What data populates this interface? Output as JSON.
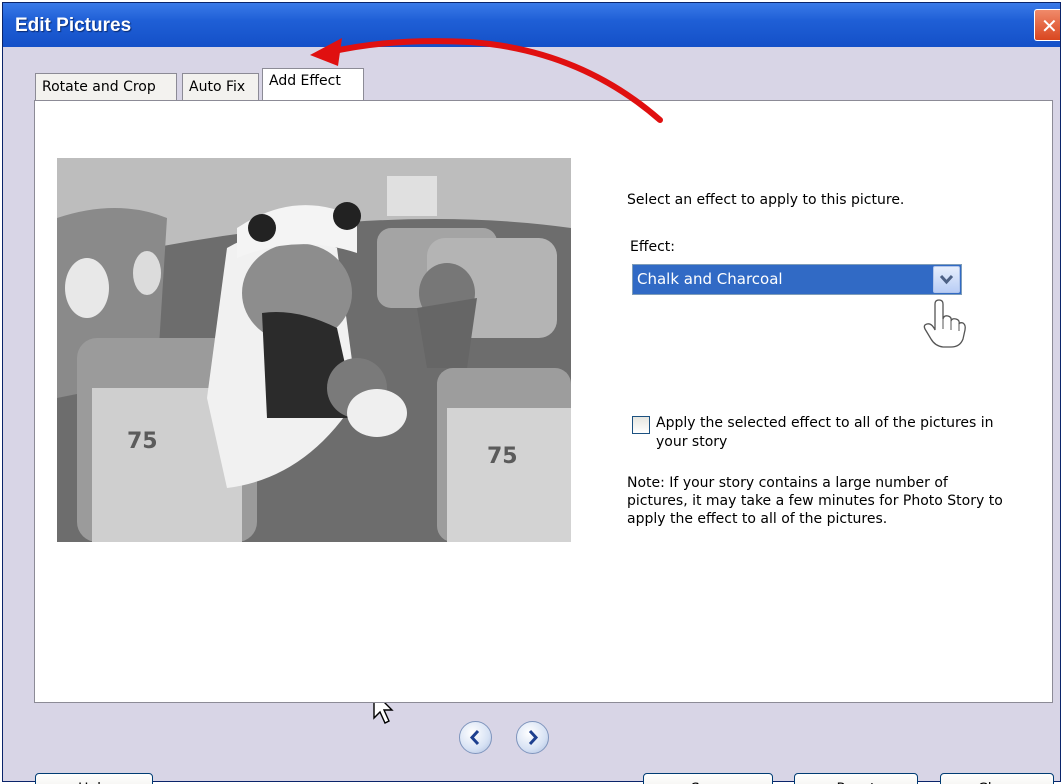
{
  "window": {
    "title": "Edit Pictures"
  },
  "tabs": [
    {
      "label": "Rotate and Crop"
    },
    {
      "label": "Auto Fix"
    },
    {
      "label": "Add Effect"
    }
  ],
  "effect_panel": {
    "instruction": "Select an effect to apply to this picture.",
    "effect_label": "Effect:",
    "effect_value": "Chalk and Charcoal",
    "apply_all_label": "Apply the selected effect to all of the pictures in your story",
    "apply_all_checked": false,
    "note": "Note: If your story contains a large number of pictures, it may take a few minutes for Photo Story to apply the effect to all of the pictures."
  },
  "buttons": {
    "help": "Help",
    "save": "Save",
    "reset": "Reset",
    "close": "Close"
  },
  "colors": {
    "titlebar": "#1f5fd6",
    "selection": "#316ac5",
    "annotation_arrow": "#e01010"
  },
  "icons": [
    "close-icon",
    "chevron-down-icon",
    "hand-cursor-icon",
    "previous-icon",
    "next-icon",
    "arrow-cursor-icon"
  ]
}
